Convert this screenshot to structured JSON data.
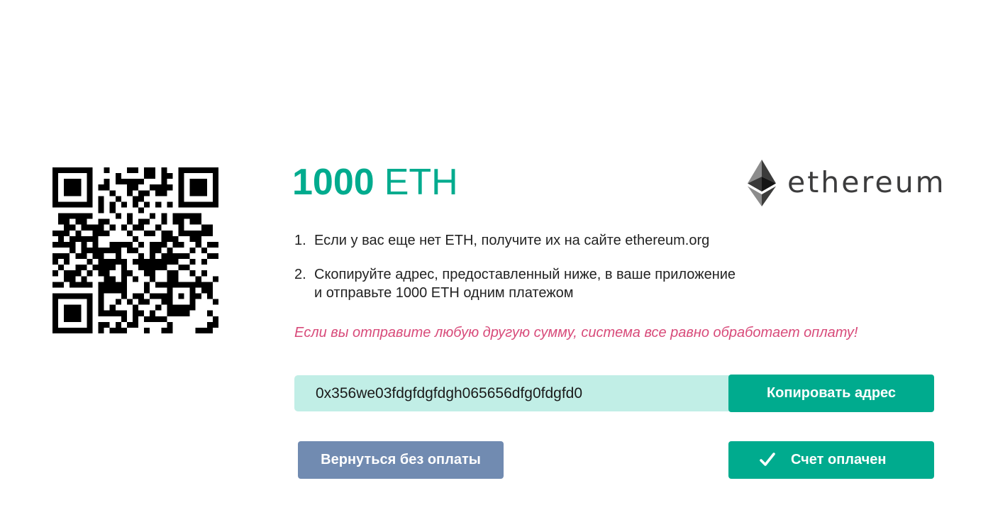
{
  "payment": {
    "amount": "1000",
    "currency": "ETH"
  },
  "brand": {
    "logo_text": "ethereum",
    "accent_color": "#00ab8e"
  },
  "instructions": {
    "step1_number": "1.",
    "step1_text": "Если у вас еще нет ETH, получите их на сайте ethereum.org",
    "step2_number": "2.",
    "step2_line1": "Скопируйте адрес, предоставленный ниже, в ваше приложение",
    "step2_line2": "и отправьте 1000 ETH одним платежом"
  },
  "warning": "Если вы отправите любую другую сумму, система все равно обработает оплату!",
  "address": {
    "value": "0x356we03fdgfdgfdgh065656dfg0fdgfd0"
  },
  "buttons": {
    "copy_label": "Копировать адрес",
    "back_label": "Вернуться без оплаты",
    "paid_label": "Счет оплачен"
  },
  "icons": {
    "qr": "qr-code-icon",
    "logo": "ethereum-diamond-icon",
    "check": "check-icon"
  },
  "colors": {
    "primary": "#00ab8e",
    "field_bg": "#c1eee6",
    "secondary_button": "#718bb1",
    "warning": "#d84b7a"
  }
}
